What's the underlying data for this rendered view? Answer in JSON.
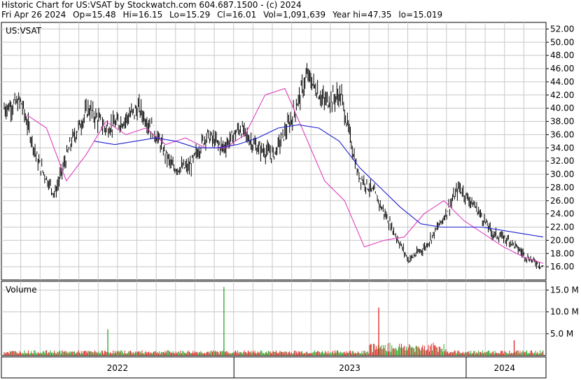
{
  "header": {
    "line1": "Historic Chart for US:VSAT by Stockwatch.com 604.687.1500 - (c) 2024",
    "date": "Fri Apr 26 2024",
    "open": "Op=15.48",
    "high": "Hi=16.15",
    "low": "Lo=15.29",
    "close": "Cl=16.01",
    "volume": "Vol=1,091,639",
    "year_hi": "Year hi=47.35",
    "year_lo": "lo=15.019"
  },
  "colors": {
    "price_bars": "#000000",
    "ma_short": "#e040c0",
    "ma_long": "#2020d0",
    "vol_up": "#22aa22",
    "vol_down": "#dd2222",
    "grid": "#c8c8c8"
  },
  "chart_data": [
    {
      "type": "line",
      "title": "US:VSAT",
      "ylim": [
        14,
        53
      ],
      "y_ticks": [
        "52.00",
        "50.00",
        "48.00",
        "46.00",
        "44.00",
        "42.00",
        "40.00",
        "38.00",
        "36.00",
        "34.00",
        "32.00",
        "30.00",
        "28.00",
        "26.00",
        "24.00",
        "22.00",
        "20.00",
        "18.00",
        "16.00"
      ],
      "x_ticks": [
        "2022",
        "2023",
        "2024"
      ],
      "x": [
        "2022-01",
        "2022-02",
        "2022-03",
        "2022-04",
        "2022-05",
        "2022-06",
        "2022-07",
        "2022-08",
        "2022-09",
        "2022-10",
        "2022-11",
        "2022-12",
        "2023-01",
        "2023-02",
        "2023-03",
        "2023-04",
        "2023-05",
        "2023-06",
        "2023-07",
        "2023-08",
        "2023-09",
        "2023-10",
        "2023-11",
        "2023-12",
        "2024-01",
        "2024-02",
        "2024-03",
        "2024-04"
      ],
      "series": [
        {
          "values": [
            40.0,
            41.0,
            32.0,
            27.0,
            35.0,
            40.0,
            37.0,
            38.0,
            40.0,
            36.0,
            31.0,
            31.0,
            36.0,
            34.0,
            37.0,
            34.0,
            33.0,
            38.0,
            45.0,
            41.0,
            42.0,
            30.0,
            27.0,
            22.0,
            17.0,
            19.0,
            23.0,
            28.0,
            25.0,
            21.0,
            20.0,
            17.5,
            16.0
          ]
        },
        {
          "values": [
            39.0,
            37.0,
            29.0,
            33.0,
            38.0,
            36.0,
            37.0,
            34.5,
            35.5,
            34.0,
            34.0,
            36.0,
            42.0,
            43.0,
            36.0,
            29.0,
            26.0,
            19.0,
            20.0,
            20.5,
            24.0,
            26.0,
            23.0,
            21.0,
            19.0,
            17.5,
            16.5
          ]
        },
        {
          "values": [
            35.0,
            34.5,
            35.0,
            35.5,
            35.0,
            34.0,
            34.0,
            34.5,
            35.5,
            37.0,
            37.5,
            37.0,
            35.0,
            31.0,
            28.0,
            25.0,
            22.5,
            22.0,
            22.0,
            22.0,
            21.5,
            21.0,
            20.5
          ]
        }
      ]
    },
    {
      "type": "bar",
      "title": "Volume",
      "ylim": [
        0,
        17
      ],
      "y_ticks": [
        "15.0 M",
        "10.0 M",
        "5.0 M"
      ],
      "spikes": [
        {
          "date": "2022-06",
          "value": 6.0
        },
        {
          "date": "2022-12",
          "value": 15.7
        },
        {
          "date": "2023-08",
          "value": 11.0
        },
        {
          "date": "2024-03",
          "value": 3.5
        }
      ]
    }
  ]
}
